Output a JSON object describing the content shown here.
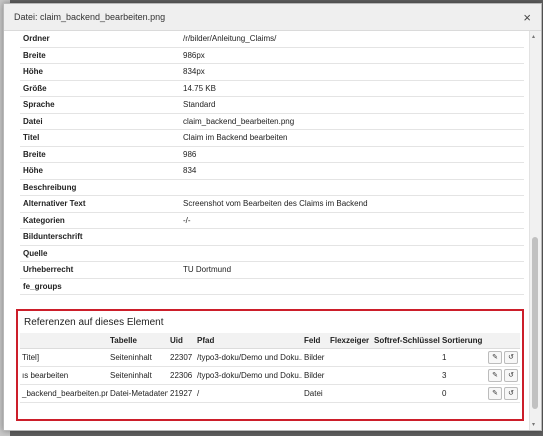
{
  "modal": {
    "title": "Datei: claim_backend_bearbeiten.png",
    "close_glyph": "×"
  },
  "meta_rows": [
    {
      "key": "Ordner",
      "value": "/r/bilder/Anleitung_Claims/"
    },
    {
      "key": "Breite",
      "value": "986px"
    },
    {
      "key": "Höhe",
      "value": "834px"
    },
    {
      "key": "Größe",
      "value": "14.75 KB"
    },
    {
      "key": "Sprache",
      "value": "Standard"
    },
    {
      "key": "Datei",
      "value": "claim_backend_bearbeiten.png"
    },
    {
      "key": "Titel",
      "value": "Claim im Backend bearbeiten"
    },
    {
      "key": "Breite",
      "value": "986"
    },
    {
      "key": "Höhe",
      "value": "834"
    },
    {
      "key": "Beschreibung",
      "value": ""
    },
    {
      "key": "Alternativer Text",
      "value": "Screenshot vom Bearbeiten des Claims im Backend"
    },
    {
      "key": "Kategorien",
      "value": "-/-"
    },
    {
      "key": "Bildunterschrift",
      "value": ""
    },
    {
      "key": "Quelle",
      "value": ""
    },
    {
      "key": "Urheberrecht",
      "value": "TU Dortmund"
    },
    {
      "key": "fe_groups",
      "value": ""
    }
  ],
  "references": {
    "title": "Referenzen auf dieses Element",
    "headers": [
      "",
      "Tabelle",
      "Uid",
      "Pfad",
      "Feld",
      "Flexzeiger",
      "Softref-Schlüssel",
      "Sortierung",
      ""
    ],
    "rows": [
      {
        "name": "Titel]",
        "table": "Seiteninhalt",
        "uid": "22307",
        "path": "/typo3-doku/Demo und Doku...",
        "field": "Bilder",
        "flex": "",
        "softref": "",
        "sort": "1"
      },
      {
        "name": "ıs bearbeiten",
        "table": "Seiteninhalt",
        "uid": "22306",
        "path": "/typo3-doku/Demo und Doku...",
        "field": "Bilder",
        "flex": "",
        "softref": "",
        "sort": "3"
      },
      {
        "name": "_backend_bearbeiten.png",
        "table": "Datei-Metadaten",
        "uid": "21927",
        "path": "/",
        "field": "Datei",
        "flex": "",
        "softref": "",
        "sort": "0"
      }
    ],
    "edit_icon_glyph": "✎",
    "history_icon_glyph": "↺",
    "scroll_left_glyph": "◂",
    "scroll_right_glyph": "▸"
  },
  "scroll": {
    "up_glyph": "▴",
    "down_glyph": "▾"
  },
  "colors": {
    "highlight_border": "#cc1e2a",
    "header_bg": "#efefef"
  }
}
